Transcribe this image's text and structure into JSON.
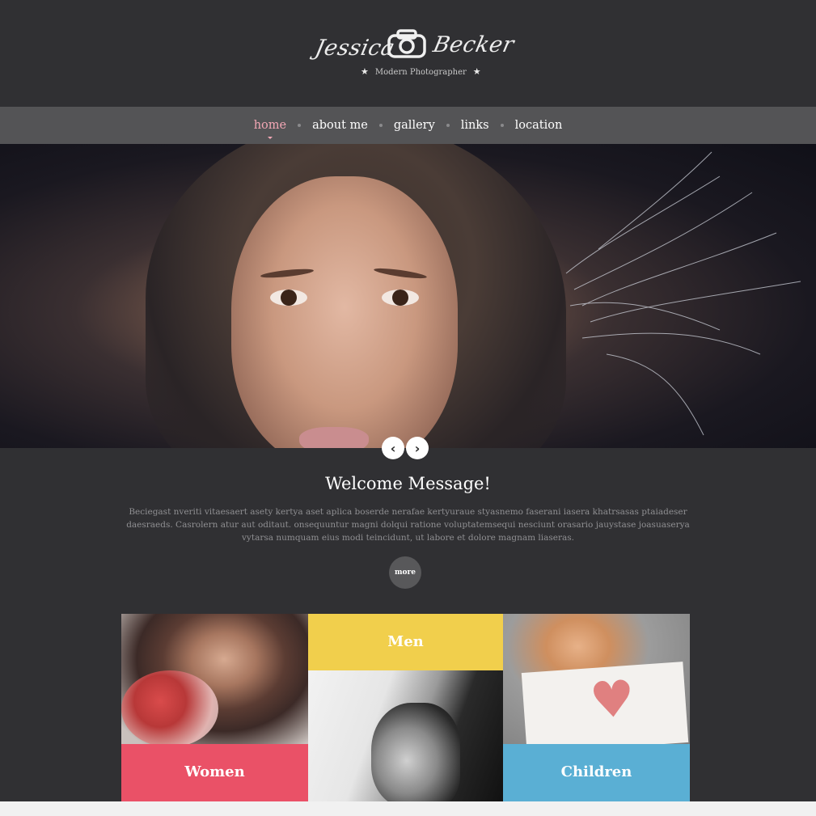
{
  "header": {
    "logo_first": "Jessica",
    "logo_last": "Becker",
    "logo_icon": "camera-icon",
    "tagline": "Modern Photographer",
    "star": "★"
  },
  "nav": {
    "items": [
      {
        "label": "home",
        "active": true
      },
      {
        "label": "about me",
        "active": false
      },
      {
        "label": "gallery",
        "active": false
      },
      {
        "label": "links",
        "active": false
      },
      {
        "label": "location",
        "active": false
      }
    ],
    "active_color": "#f3a7b5"
  },
  "slider": {
    "prev_icon": "chevron-left-icon",
    "next_icon": "chevron-right-icon",
    "prev_glyph": "‹",
    "next_glyph": "›"
  },
  "welcome": {
    "title": "Welcome Message!",
    "text": "Beciegast nveriti vitaesaert asety kertya aset aplica boserde nerafae kertyuraue styasnemo faserani iasera khatrsasas ptaiadeser daesraeds. Casrolern atur aut oditaut. onsequuntur magni dolqui ratione voluptatemsequi nesciunt orasario jauystase joasuaserya vytarsa numquam eius modi teincidunt, ut labore et dolore magnam liaseras.",
    "more": "more"
  },
  "categories": [
    {
      "label": "Women",
      "color": "#ea5167"
    },
    {
      "label": "Men",
      "color": "#f1cf4c"
    },
    {
      "label": "Children",
      "color": "#5aafd4"
    }
  ],
  "colors": {
    "background": "#303033",
    "nav_bar": "#545456",
    "more_button": "#58585a"
  }
}
